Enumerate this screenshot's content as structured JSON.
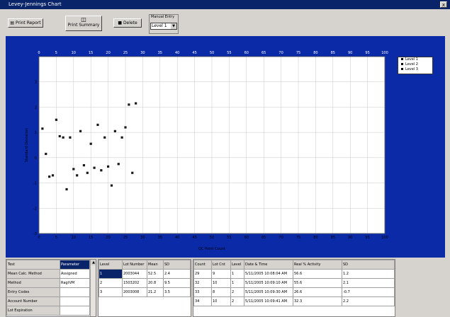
{
  "window": {
    "title": "Levey-Jennings Chart",
    "close_label": "x"
  },
  "toolbar": {
    "print_report": "Print Report",
    "print_summary": "Print Summary",
    "delete": "Delete",
    "manual_entry_label": "Manual Entry",
    "level_value": "Level 1",
    "dropdown_arrow": "▼"
  },
  "chart_data": {
    "type": "scatter",
    "xlabel": "QC Point Count",
    "ylabel": "Standard Deviation",
    "xlim": [
      0,
      100
    ],
    "ylim": [
      -3,
      4
    ],
    "x_ticks": [
      "0",
      "5",
      "10",
      "15",
      "20",
      "25",
      "30",
      "35",
      "40",
      "45",
      "50",
      "55",
      "60",
      "65",
      "70",
      "75",
      "80",
      "85",
      "90",
      "95",
      "100"
    ],
    "y_ticks": [
      "3",
      "2",
      "1",
      "0",
      "-1",
      "-2",
      "-3"
    ],
    "grid": true,
    "legend": {
      "placement": "right",
      "items": [
        "Level 1",
        "Level 2",
        "Level 3"
      ]
    },
    "series": [
      {
        "name": "Level 1",
        "points": [
          [
            1,
            1.15
          ],
          [
            2,
            0.15
          ],
          [
            3,
            -0.75
          ],
          [
            4,
            -0.7
          ],
          [
            5,
            1.5
          ],
          [
            6,
            0.85
          ],
          [
            7,
            0.8
          ],
          [
            8,
            -1.25
          ],
          [
            9,
            0.8
          ],
          [
            10,
            -0.45
          ],
          [
            11,
            -0.7
          ],
          [
            12,
            1.05
          ],
          [
            13,
            -0.3
          ],
          [
            14,
            -0.6
          ],
          [
            15,
            0.55
          ],
          [
            16,
            -0.4
          ],
          [
            17,
            1.3
          ],
          [
            18,
            -0.5
          ],
          [
            19,
            0.8
          ],
          [
            20,
            -0.35
          ],
          [
            21,
            -1.1
          ],
          [
            22,
            1.05
          ],
          [
            23,
            -0.25
          ],
          [
            24,
            0.8
          ],
          [
            25,
            1.2
          ],
          [
            26,
            2.1
          ],
          [
            27,
            -0.6
          ],
          [
            28,
            2.15
          ]
        ]
      }
    ]
  },
  "param_table": {
    "header": [
      "Test",
      "Parameter"
    ],
    "rows": [
      [
        "Mean Calc. Method",
        "Assigned"
      ],
      [
        "Method",
        "RagtVM"
      ],
      [
        "Entry Codes",
        ""
      ],
      [
        "Account Number",
        ""
      ],
      [
        "Lot Expiration",
        ""
      ]
    ],
    "scroll_up": "▲"
  },
  "level_table": {
    "header": [
      "Level",
      "Lot Number",
      "Mean",
      "SD"
    ],
    "rows": [
      [
        "1",
        "2003044",
        "52.5",
        "2.4"
      ],
      [
        "2",
        "1503202",
        "20.8",
        "9.5"
      ],
      [
        "3",
        "2003008",
        "21.2",
        "3.5"
      ]
    ]
  },
  "data_table": {
    "header": [
      "Count",
      "Lot Cnt",
      "Level",
      "Date & Time",
      "Real % Activity",
      "SD"
    ],
    "rows": [
      [
        "29",
        "9",
        "1",
        "5/11/2005 10:08:04 AM",
        "56.6",
        "1.2"
      ],
      [
        "32",
        "10",
        "1",
        "5/11/2005 10:09:10 AM",
        "55.6",
        "2.1"
      ],
      [
        "33",
        "8",
        "2",
        "5/11/2005 10:09:30 AM",
        "26.6",
        "-0.7"
      ],
      [
        "34",
        "10",
        "2",
        "5/11/2005 10:09:41 AM",
        "32.3",
        "2.2"
      ]
    ]
  }
}
